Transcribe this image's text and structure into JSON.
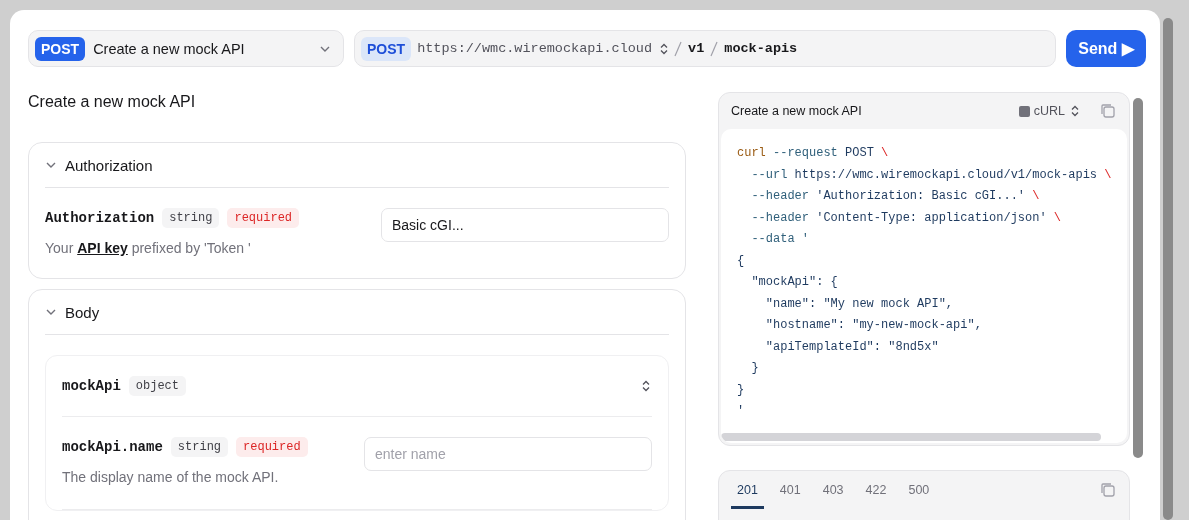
{
  "endpoint_select": {
    "method": "POST",
    "label": "Create a new mock API"
  },
  "url_bar": {
    "method": "POST",
    "base": "https://wmc.wiremockapi.cloud",
    "segments": [
      "v1",
      "mock-apis"
    ]
  },
  "send_button": {
    "label": "Send ▶"
  },
  "title": "Create a new mock API",
  "sections": [
    {
      "title": "Authorization",
      "expanded": true,
      "params": [
        {
          "name": "Authorization",
          "tags": [
            {
              "text": "string",
              "kind": "type"
            },
            {
              "text": "required",
              "kind": "required"
            }
          ],
          "description": [
            {
              "text": "Your ",
              "kind": "text"
            },
            {
              "text": "API key",
              "kind": "link"
            },
            {
              "text": " prefixed by 'Token '",
              "kind": "text"
            }
          ],
          "input": {
            "value": "Basic cGI..."
          }
        }
      ]
    },
    {
      "title": "Body",
      "expanded": true,
      "objects": [
        {
          "name": "mockApi",
          "tags": [
            {
              "text": "object",
              "kind": "type"
            }
          ],
          "params": [
            {
              "name": "mockApi.name",
              "tags": [
                {
                  "text": "string",
                  "kind": "type"
                },
                {
                  "text": "required",
                  "kind": "required"
                }
              ],
              "description": [
                {
                  "text": "The display name of the mock API.",
                  "kind": "text"
                }
              ],
              "input": {
                "placeholder": "enter name"
              }
            }
          ]
        }
      ]
    }
  ],
  "code_panel": {
    "title": "Create a new mock API",
    "language": "cURL",
    "lines": [
      [
        {
          "text": "curl",
          "kind": "command"
        },
        {
          "text": " --request ",
          "kind": "flag"
        },
        {
          "text": "POST ",
          "kind": "text"
        },
        {
          "text": "\\",
          "kind": "escape"
        }
      ],
      [
        {
          "text": "  --url ",
          "kind": "flag"
        },
        {
          "text": "https://wmc.wiremockapi.cloud/v1/mock-apis ",
          "kind": "text"
        },
        {
          "text": "\\",
          "kind": "escape"
        }
      ],
      [
        {
          "text": "  --header ",
          "kind": "flag"
        },
        {
          "text": "'Authorization: Basic cGI...' ",
          "kind": "text"
        },
        {
          "text": "\\",
          "kind": "escape"
        }
      ],
      [
        {
          "text": "  --header ",
          "kind": "flag"
        },
        {
          "text": "'Content-Type: application/json' ",
          "kind": "text"
        },
        {
          "text": "\\",
          "kind": "escape"
        }
      ],
      [
        {
          "text": "  --data '",
          "kind": "flag"
        }
      ],
      [
        {
          "text": "{",
          "kind": "text"
        }
      ],
      [
        {
          "text": "  \"mockApi\": {",
          "kind": "text"
        }
      ],
      [
        {
          "text": "    \"name\": \"My new mock API\",",
          "kind": "text"
        }
      ],
      [
        {
          "text": "    \"hostname\": \"my-new-mock-api\",",
          "kind": "text"
        }
      ],
      [
        {
          "text": "    \"apiTemplateId\": \"8nd5x\"",
          "kind": "text"
        }
      ],
      [
        {
          "text": "  }",
          "kind": "text"
        }
      ],
      [
        {
          "text": "}",
          "kind": "text"
        }
      ],
      [
        {
          "text": "'",
          "kind": "text"
        }
      ]
    ]
  },
  "responses": {
    "tabs": [
      {
        "label": "201",
        "selected": true
      },
      {
        "label": "401",
        "selected": false
      },
      {
        "label": "403",
        "selected": false
      },
      {
        "label": "422",
        "selected": false
      },
      {
        "label": "500",
        "selected": false
      }
    ]
  }
}
